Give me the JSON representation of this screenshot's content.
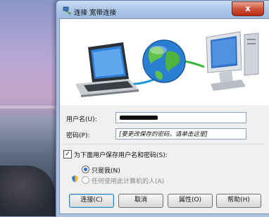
{
  "window": {
    "title": "连接 宽带连接",
    "close_label": "x"
  },
  "form": {
    "username_label": "用户名(U):",
    "username_value": "",
    "password_label": "密码(P):",
    "password_value": "[要更改保存的密码，请单击这里]"
  },
  "save": {
    "checkbox_label": "为下面用户保存用户名和密码(S):",
    "checked": true,
    "options": [
      {
        "label": "只是我(N)",
        "selected": true,
        "enabled": true
      },
      {
        "label": "任何使用此计算机的人(A)",
        "selected": false,
        "enabled": false
      }
    ]
  },
  "buttons": {
    "connect": "连接(C)",
    "cancel": "取消",
    "properties": "属性(O)",
    "help": "帮助(H)"
  },
  "icons": [
    "network-title-icon",
    "laptop-icon",
    "globe-icon",
    "monitor-icon",
    "shield-icon",
    "close-icon"
  ]
}
